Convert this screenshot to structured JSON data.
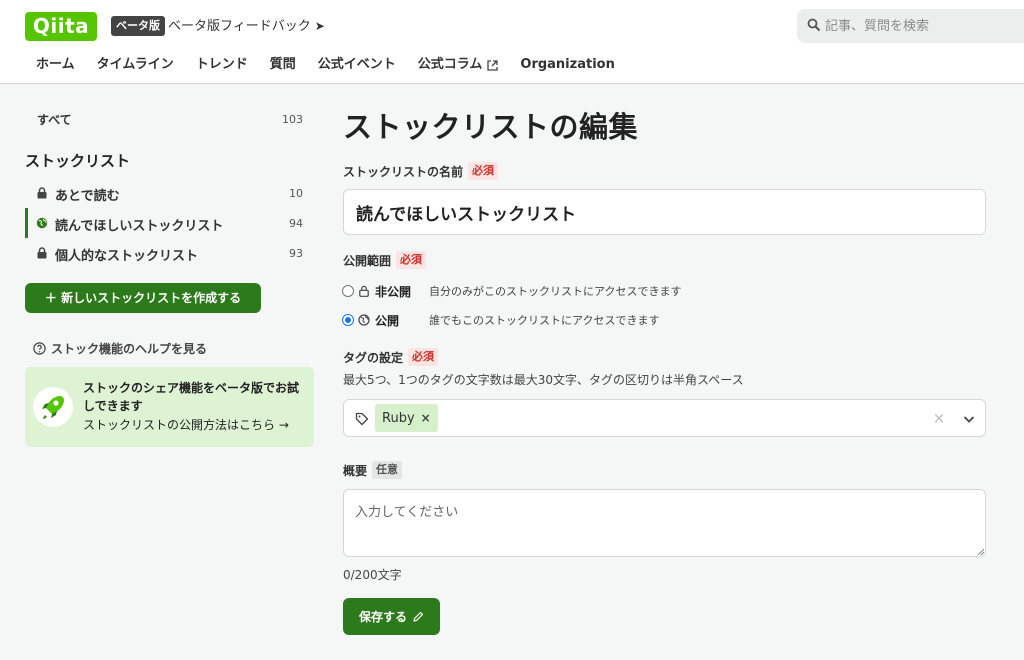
{
  "header": {
    "logo": "Qiita",
    "beta_badge": "ベータ版",
    "feedback_label": "ベータ版フィードバック",
    "search_placeholder": "記事、質問を検索",
    "nav": [
      "ホーム",
      "タイムライン",
      "トレンド",
      "質問",
      "公式イベント",
      "公式コラム",
      "Organization"
    ]
  },
  "sidebar": {
    "all_label": "すべて",
    "all_count": "103",
    "heading": "ストックリスト",
    "items": [
      {
        "label": "あとで読む",
        "count": "10",
        "visibility": "private"
      },
      {
        "label": "読んでほしいストックリスト",
        "count": "94",
        "visibility": "public"
      },
      {
        "label": "個人的なストックリスト",
        "count": "93",
        "visibility": "private"
      }
    ],
    "create_button": "＋ 新しいストックリストを作成する",
    "help_link": "ストック機能のヘルプを見る",
    "promo": {
      "title": "ストックのシェア機能をベータ版でお試しできます",
      "link": "ストックリストの公開方法はこちら"
    }
  },
  "main": {
    "title": "ストックリストの編集",
    "name_field": {
      "label": "ストックリストの名前",
      "badge": "必須",
      "value": "読んでほしいストックリスト"
    },
    "visibility_field": {
      "label": "公開範囲",
      "badge": "必須",
      "options": [
        {
          "label": "非公開",
          "desc": "自分のみがこのストックリストにアクセスできます",
          "checked": false
        },
        {
          "label": "公開",
          "desc": "誰でもこのストックリストにアクセスできます",
          "checked": true
        }
      ]
    },
    "tags_field": {
      "label": "タグの設定",
      "badge": "必須",
      "hint": "最大5つ、1つのタグの文字数は最大30文字、タグの区切りは半角スペース",
      "tags": [
        "Ruby"
      ]
    },
    "summary_field": {
      "label": "概要",
      "badge": "任意",
      "placeholder": "入力してください",
      "counter": "0/200文字"
    },
    "save_button": "保存する"
  },
  "colors": {
    "brand": "#55c500",
    "primary_button": "#2c7a1b",
    "required_badge": "#c9302c",
    "promo_bg": "#ddf3d3"
  }
}
